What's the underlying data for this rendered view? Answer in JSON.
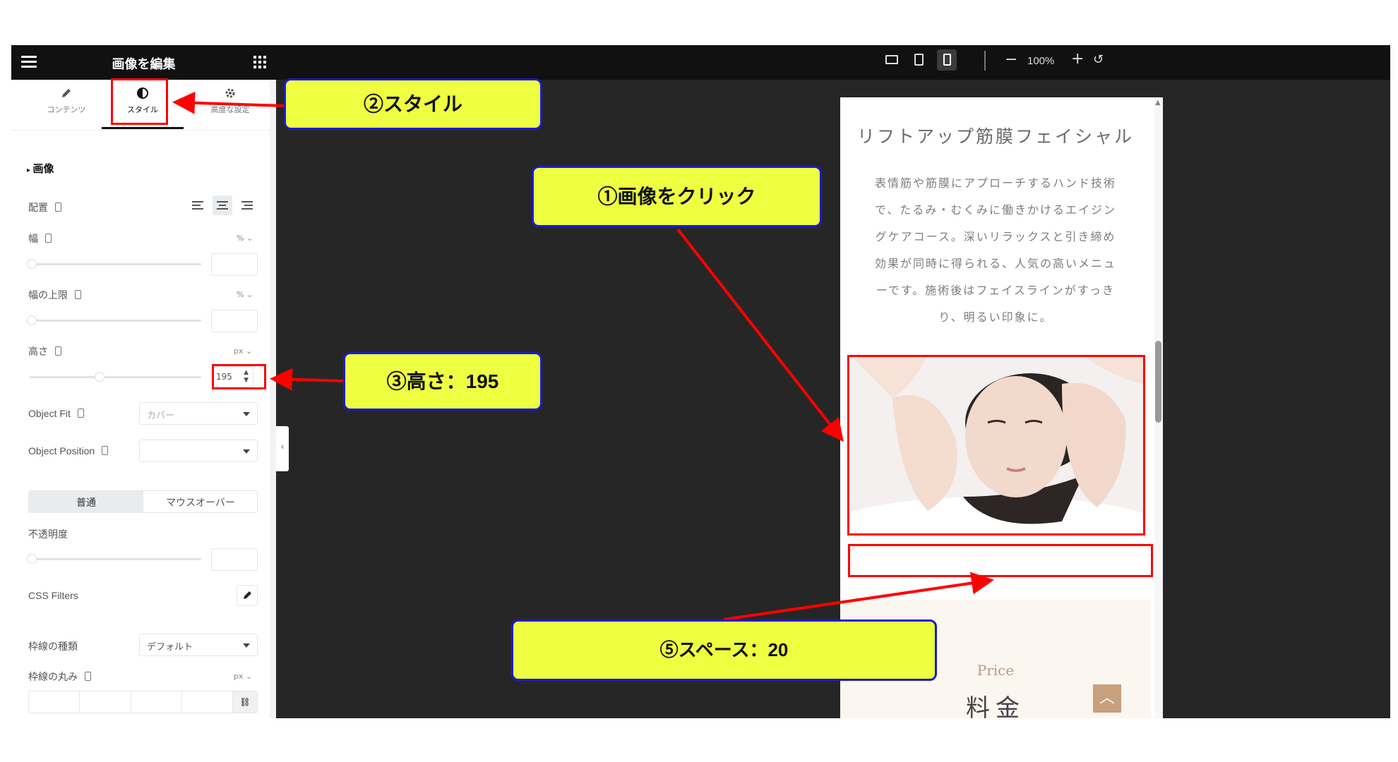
{
  "panel": {
    "title": "画像を編集",
    "tabs": [
      {
        "label": "コンテンツ",
        "icon": "pencil-icon"
      },
      {
        "label": "スタイル",
        "icon": "contrast-icon"
      },
      {
        "label": "高度な設定",
        "icon": "gear-icon"
      }
    ],
    "section_title": "画像",
    "fields": {
      "alignment_label": "配置",
      "width_label": "幅",
      "width_unit": "% ⌄",
      "max_width_label": "幅の上限",
      "max_width_unit": "% ⌄",
      "height_label": "高さ",
      "height_unit": "px ⌄",
      "height_value": "195",
      "object_fit_label": "Object Fit",
      "object_fit_value": "カバー",
      "object_position_label": "Object Position",
      "object_position_value": "",
      "normal_tab": "普通",
      "hover_tab": "マウスオーバー",
      "opacity_label": "不透明度",
      "css_filters_label": "CSS Filters",
      "border_type_label": "枠線の種類",
      "border_type_value": "デフォルト",
      "border_radius_label": "枠線の丸み",
      "border_radius_unit": "px ⌄"
    }
  },
  "topbar": {
    "zoom": "100%",
    "minus": "−",
    "plus": "+"
  },
  "preview": {
    "title": "リフトアップ筋膜フェイシャル",
    "body_lines": [
      "表情筋や筋膜にアプローチするハンド技術",
      "で、たるみ・むくみに働きかけるエイジン",
      "グケアコース。深いリラックスと引き締め",
      "効果が同時に得られる、人気の高いメニュ",
      "ーです。施術後はフェイスラインがすっき",
      "り、明るい印象に。"
    ],
    "price_label": "Price",
    "price_heading": "料金",
    "up_icon": "chevron-up-icon"
  },
  "callouts": {
    "step1": "①画像をクリック",
    "step2": "②スタイル",
    "step3": "③高さ：195",
    "step5": "⑤スペース：20"
  },
  "colors": {
    "callout_bg": "#eeff41",
    "callout_border": "#1a1ad6",
    "highlight": "#ff0000",
    "topbar": "#111111",
    "canvas": "#262626"
  }
}
